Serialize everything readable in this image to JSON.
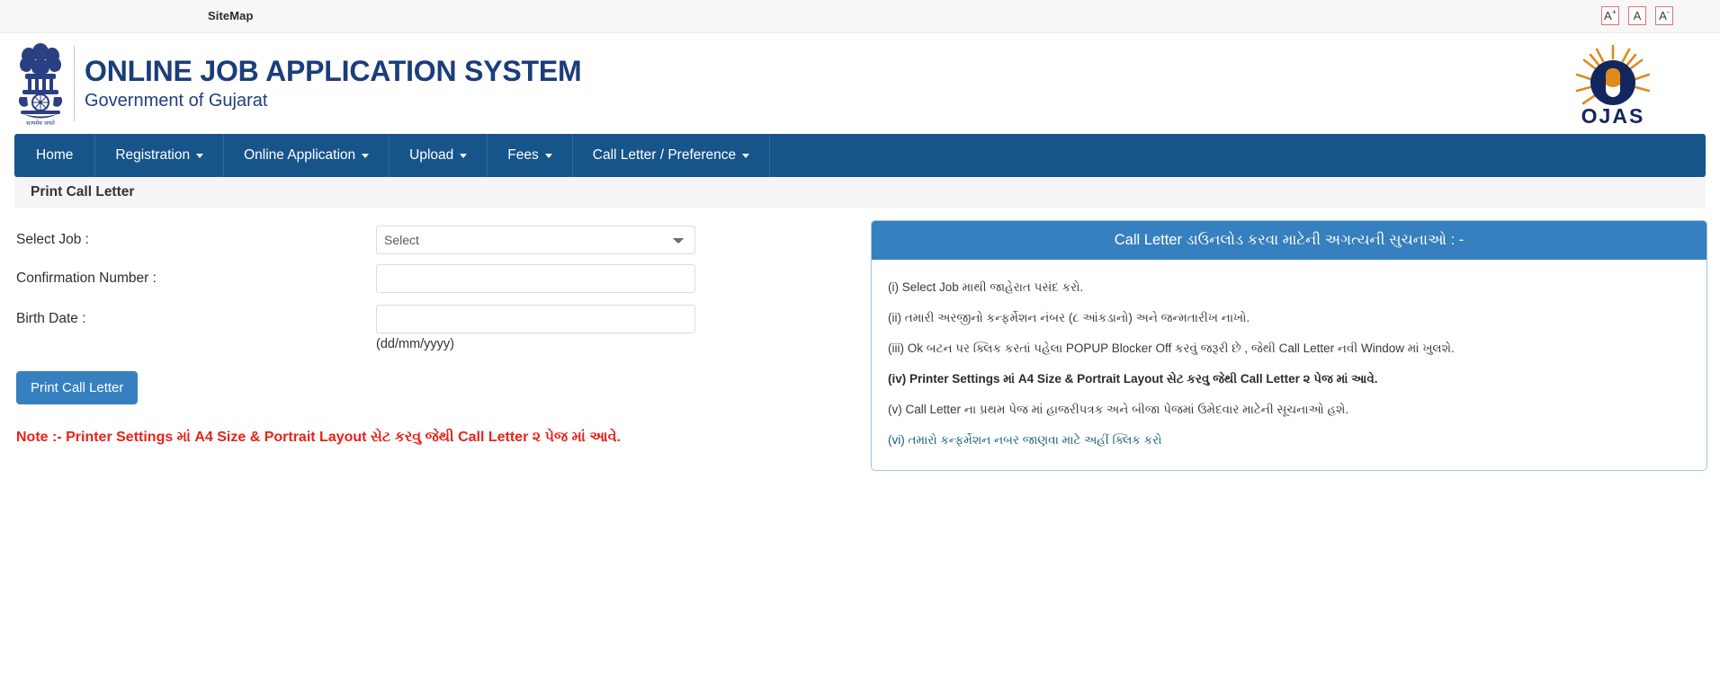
{
  "topbar": {
    "sitemap_label": "SiteMap",
    "font_buttons": [
      {
        "name": "font-increase",
        "base": "A",
        "sup": "+"
      },
      {
        "name": "font-normal",
        "base": "A",
        "sup": ""
      },
      {
        "name": "font-decrease",
        "base": "A",
        "sup": "-"
      }
    ],
    "font_button_border_color": "#d9756d"
  },
  "masthead": {
    "emblem_name": "india-national-emblem-icon",
    "title": "ONLINE JOB APPLICATION SYSTEM",
    "subtitle": "Government of Gujarat",
    "title_color": "#1b3d7a",
    "logo_name": "ojas-logo",
    "logo_text": "OJAS",
    "logo_navy": "#14265e",
    "logo_orange": "#e08a1e"
  },
  "nav": {
    "background_color": "#17548a",
    "items": [
      {
        "label": "Home",
        "caret": false
      },
      {
        "label": "Registration",
        "caret": true
      },
      {
        "label": "Online Application",
        "caret": true
      },
      {
        "label": "Upload",
        "caret": true
      },
      {
        "label": "Fees",
        "caret": true
      },
      {
        "label": "Call Letter / Preference",
        "caret": true
      }
    ]
  },
  "page": {
    "title": "Print Call Letter"
  },
  "form": {
    "fields": [
      {
        "label": "Select Job :",
        "type": "select",
        "value": "Select"
      },
      {
        "label": "Confirmation Number :",
        "type": "text",
        "value": "",
        "placeholder": ""
      },
      {
        "label": "Birth Date :",
        "type": "text",
        "value": "",
        "placeholder": ""
      }
    ],
    "select_job_label": "Select Job :",
    "select_job_value": "Select",
    "confirmation_label": "Confirmation Number :",
    "confirmation_value": "",
    "birthdate_label": "Birth Date :",
    "birthdate_value": "",
    "birthdate_hint": "(dd/mm/yyyy)",
    "submit_label": "Print Call Letter",
    "submit_color": "#3680bf",
    "note": "Note :- Printer Settings માં A4 Size & Portrait Layout સેટ કરવુ જેથી Call Letter ૨ પેજ માં આવે.",
    "note_color": "#e8231a"
  },
  "instructions": {
    "heading": "Call Letter ડાઉનલોડ કરવા માટેની અગત્યની સુચનાઓ : -",
    "heading_bg": "#3680bf",
    "border_color": "#9dc3e0",
    "items": [
      {
        "text": "(i) Select Job માથી જાહેરાત પસંદ કરો.",
        "style": "normal"
      },
      {
        "text": "(ii) તમારી અરજીનો કન્ફર્મેશન નંબર (૮ આંકડાનો) અને જન્મતારીખ નાખો.",
        "style": "normal"
      },
      {
        "text": "(iii) Ok બટન પર ક્લિક કરતાં પહેલા POPUP Blocker Off કરવું જરૂરી છે , જેથી Call Letter નવી Window માં ખુલશે.",
        "style": "normal"
      },
      {
        "text": "(iv) Printer Settings માં A4 Size & Portrait Layout સેટ કરવુ જેથી Call Letter ૨ પેજ માં આવે.",
        "style": "bold"
      },
      {
        "text": "(v) Call Letter ના પ્રથમ પેજ માં હાજરીપત્રક અને બીજા પેજમાં ઉમેદવાર માટેની સૂચનાઓ હશે.",
        "style": "normal"
      },
      {
        "text": "(vi) તમારો કન્ફર્મેશન નબર જાણવા માટે અહીં ક્લિક કરો",
        "style": "link"
      }
    ],
    "link_color": "#16607a"
  }
}
